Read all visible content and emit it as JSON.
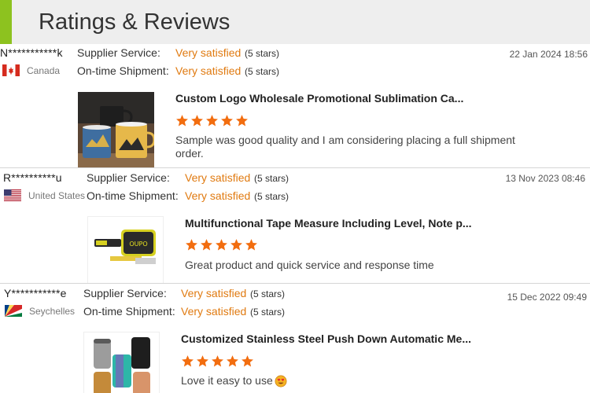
{
  "header": {
    "title": "Ratings & Reviews",
    "accent_color": "#8dc21f"
  },
  "labels": {
    "supplier_service": "Supplier Service:",
    "on_time_shipment": "On-time Shipment:"
  },
  "colors": {
    "satisfied": "#e07a10",
    "star": "#f26d0f"
  },
  "reviews": [
    {
      "reviewer": "N***********k",
      "country": "Canada",
      "flag_icon": "canada-flag-icon",
      "supplier_service": {
        "text": "Very satisfied",
        "stars": "(5 stars)"
      },
      "on_time_shipment": {
        "text": "Very satisfied",
        "stars": "(5 stars)"
      },
      "date": "22 Jan 2024 18:56",
      "product_title": "Custom Logo Wholesale Promotional Sublimation Ca...",
      "product_rating": 5,
      "comment": "Sample was good quality and I am considering placing a full shipment order.",
      "thumbnail_icon": "enamel-mugs-product-image"
    },
    {
      "reviewer": "R**********u",
      "country": "United States",
      "flag_icon": "us-flag-icon",
      "supplier_service": {
        "text": "Very satisfied",
        "stars": "(5 stars)"
      },
      "on_time_shipment": {
        "text": "Very satisfied",
        "stars": "(5 stars)"
      },
      "date": "13 Nov 2023 08:46",
      "product_title": "Multifunctional Tape Measure Including Level, Note p...",
      "product_rating": 5,
      "comment": "Great product and quick service and response time",
      "thumbnail_icon": "tape-measure-product-image"
    },
    {
      "reviewer": "Y***********e",
      "country": "Seychelles",
      "flag_icon": "seychelles-flag-icon",
      "supplier_service": {
        "text": "Very satisfied",
        "stars": "(5 stars)"
      },
      "on_time_shipment": {
        "text": "Very satisfied",
        "stars": "(5 stars)"
      },
      "date": "15 Dec 2022 09:49",
      "product_title": "Customized Stainless Steel Push Down Automatic Me...",
      "product_rating": 5,
      "comment": "Love it easy to use",
      "comment_emoji_icon": "heart-eyes-emoji-icon",
      "thumbnail_icon": "stainless-tumblers-product-image"
    }
  ]
}
